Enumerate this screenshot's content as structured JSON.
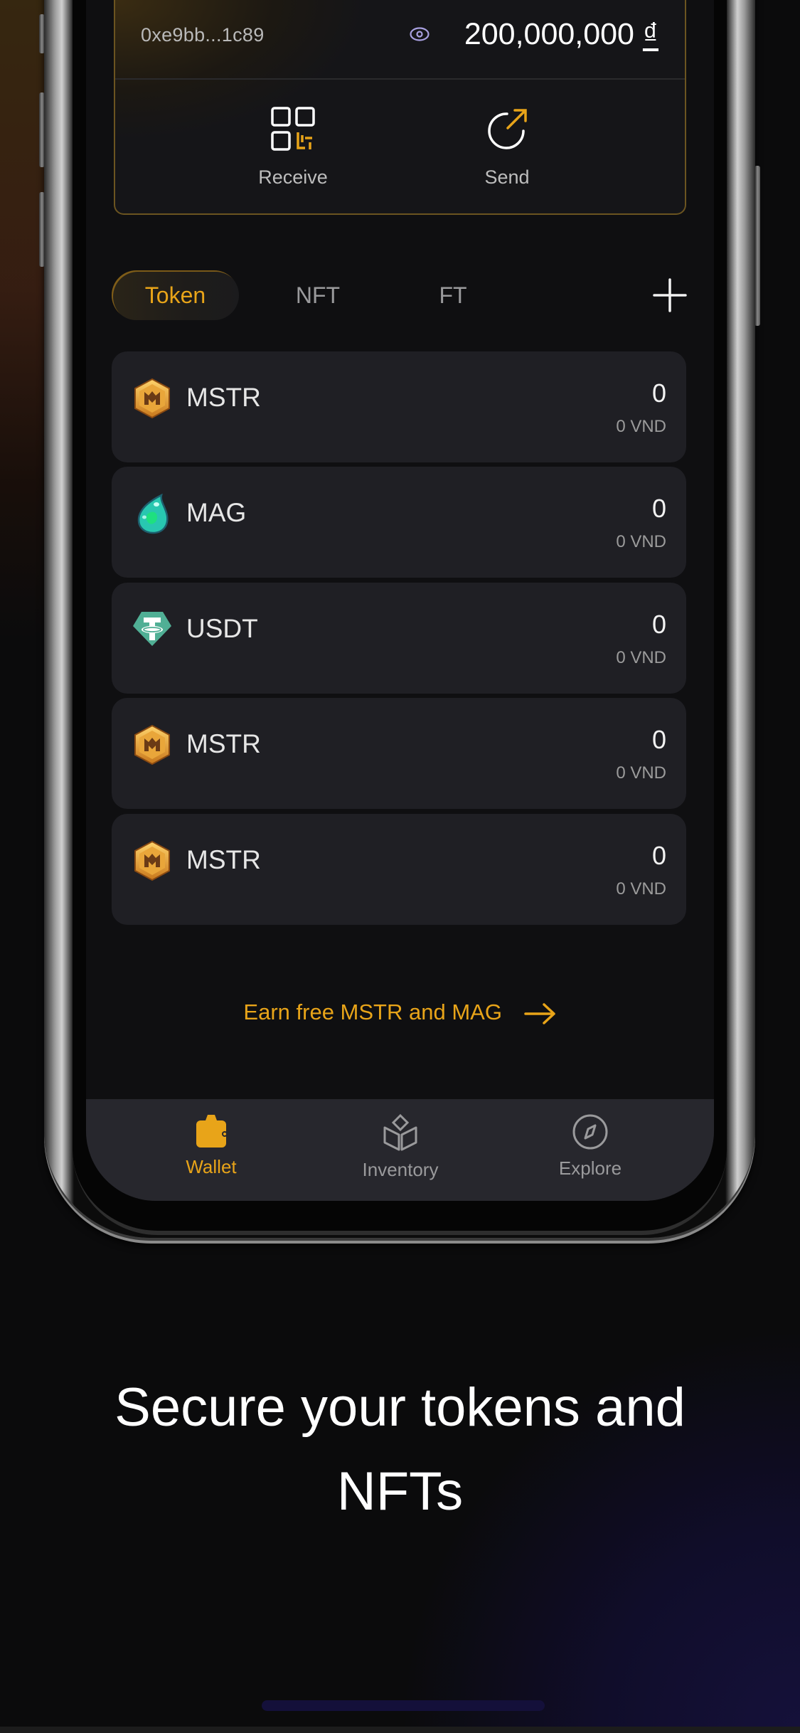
{
  "wallet": {
    "address": "0xe9bb...1c89",
    "balance": "200,000,000",
    "currency_symbol": "₫",
    "actions": [
      {
        "label": "Receive",
        "icon": "qr-code-icon"
      },
      {
        "label": "Send",
        "icon": "send-arrow-icon"
      }
    ]
  },
  "tabs": [
    {
      "label": "Token",
      "active": true
    },
    {
      "label": "NFT",
      "active": false
    },
    {
      "label": "FT",
      "active": false
    }
  ],
  "add_label": "+",
  "tokens": [
    {
      "symbol": "MSTR",
      "icon": "mstr-coin-icon",
      "amount": "0",
      "fiat": "0 VND"
    },
    {
      "symbol": "MAG",
      "icon": "mag-gem-icon",
      "amount": "0",
      "fiat": "0 VND"
    },
    {
      "symbol": "USDT",
      "icon": "usdt-tether-icon",
      "amount": "0",
      "fiat": "0 VND"
    },
    {
      "symbol": "MSTR",
      "icon": "mstr-coin-icon",
      "amount": "0",
      "fiat": "0 VND"
    },
    {
      "symbol": "MSTR",
      "icon": "mstr-coin-icon",
      "amount": "0",
      "fiat": "0 VND"
    }
  ],
  "earn_link": "Earn free MSTR and MAG",
  "nav": [
    {
      "label": "Wallet",
      "icon": "wallet-icon",
      "active": true
    },
    {
      "label": "Inventory",
      "icon": "cube-icon",
      "active": false
    },
    {
      "label": "Explore",
      "icon": "compass-icon",
      "active": false
    }
  ],
  "headline": {
    "line1": "Secure your tokens and",
    "line2": "NFTs"
  },
  "colors": {
    "accent": "#e8a419",
    "eye_icon": "#a8a0e0",
    "usdt": "#50af95",
    "mag": "#2fd3b3"
  }
}
